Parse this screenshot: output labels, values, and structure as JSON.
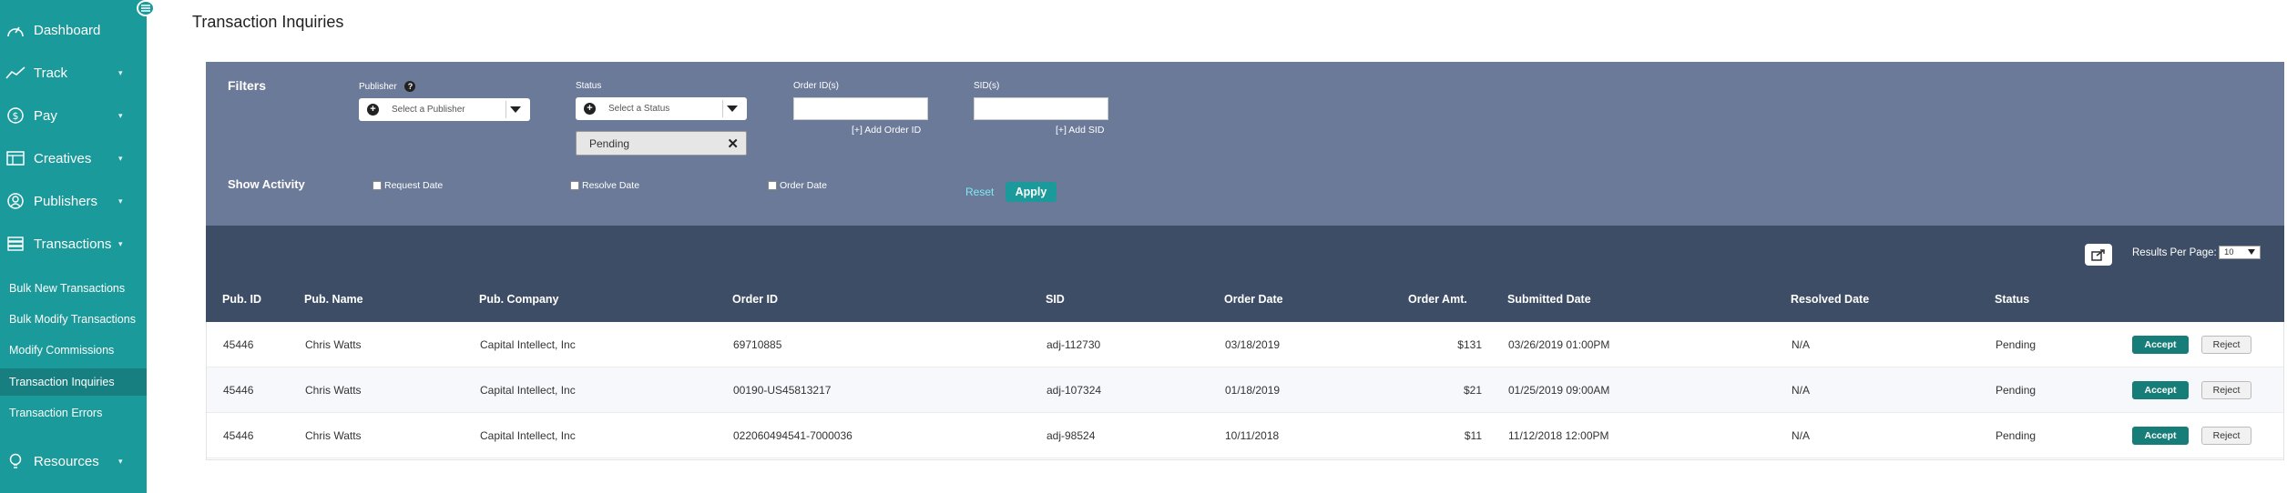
{
  "page": {
    "title": "Transaction Inquiries"
  },
  "sidebar": {
    "main_items": [
      {
        "label": "Dashboard",
        "icon": "dashboard-icon"
      },
      {
        "label": "Track",
        "icon": "chart-line-icon"
      },
      {
        "label": "Pay",
        "icon": "dollar-icon"
      },
      {
        "label": "Creatives",
        "icon": "window-icon"
      },
      {
        "label": "Publishers",
        "icon": "users-icon"
      },
      {
        "label": "Transactions",
        "icon": "stack-icon"
      }
    ],
    "sub_items": [
      {
        "label": "Bulk New Transactions"
      },
      {
        "label": "Bulk Modify Transactions"
      },
      {
        "label": "Modify Commissions"
      },
      {
        "label": "Transaction Inquiries",
        "active": true
      },
      {
        "label": "Transaction Errors"
      }
    ],
    "resources": {
      "label": "Resources",
      "icon": "lightbulb-icon"
    }
  },
  "filters": {
    "title": "Filters",
    "publisher": {
      "label": "Publisher",
      "placeholder": "Select a Publisher"
    },
    "status": {
      "label": "Status",
      "placeholder": "Select a Status",
      "selected_chip": "Pending"
    },
    "order_ids": {
      "label": "Order ID(s)",
      "add_link": "[+] Add Order ID"
    },
    "sids": {
      "label": "SID(s)",
      "add_link": "[+] Add SID"
    },
    "show_activity": {
      "title": "Show Activity",
      "options": [
        "Request Date",
        "Resolve Date",
        "Order Date"
      ]
    },
    "reset_label": "Reset",
    "apply_label": "Apply"
  },
  "toolbar": {
    "results_per_page_label": "Results Per Page:",
    "results_per_page_value": "10"
  },
  "table": {
    "headers": [
      "Pub. ID",
      "Pub. Name",
      "Pub. Company",
      "Order ID",
      "SID",
      "Order Date",
      "Order Amt.",
      "Submitted Date",
      "Resolved Date",
      "Status"
    ],
    "rows": [
      {
        "pub_id": "45446",
        "pub_name": "Chris Watts",
        "pub_company": "Capital Intellect, Inc",
        "order_id": "69710885",
        "sid": "adj-112730",
        "order_date": "03/18/2019",
        "order_amt": "$131",
        "submitted_date": "03/26/2019 01:00PM",
        "resolved_date": "N/A",
        "status": "Pending",
        "accept": "Accept",
        "reject": "Reject"
      },
      {
        "pub_id": "45446",
        "pub_name": "Chris Watts",
        "pub_company": "Capital Intellect, Inc",
        "order_id": "00190-US45813217",
        "sid": "adj-107324",
        "order_date": "01/18/2019",
        "order_amt": "$21",
        "submitted_date": "01/25/2019 09:00AM",
        "resolved_date": "N/A",
        "status": "Pending",
        "accept": "Accept",
        "reject": "Reject"
      },
      {
        "pub_id": "45446",
        "pub_name": "Chris Watts",
        "pub_company": "Capital Intellect, Inc",
        "order_id": "022060494541-7000036",
        "sid": "adj-98524",
        "order_date": "10/11/2018",
        "order_amt": "$11",
        "submitted_date": "11/12/2018 12:00PM",
        "resolved_date": "N/A",
        "status": "Pending",
        "accept": "Accept",
        "reject": "Reject"
      }
    ]
  },
  "colors": {
    "sidebar": "#1a9a9a",
    "filters_panel": "#6b7a99",
    "table_header": "#3e4d66",
    "accept_button": "#167d78"
  }
}
